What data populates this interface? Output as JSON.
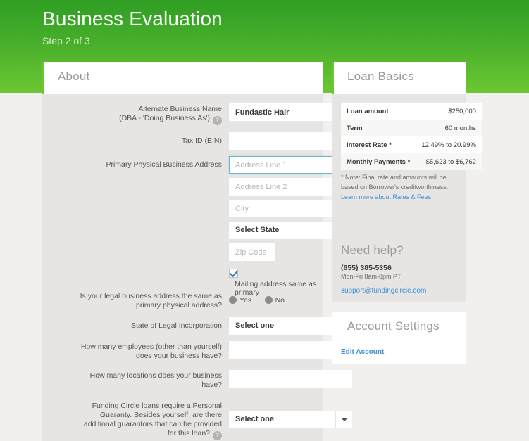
{
  "header": {
    "title": "Business Evaluation",
    "step": "Step 2 of 3"
  },
  "about": {
    "heading": "About",
    "fields": {
      "alt_name_label_line1": "Alternate Business Name",
      "alt_name_label_line2": "(DBA - 'Doing Business As')",
      "alt_name_value": "Fundastic Hair",
      "tax_id_label": "Tax ID (EIN)",
      "tax_id_value": "",
      "address_label": "Primary Physical Business Address",
      "address1_placeholder": "Address Line 1",
      "address2_placeholder": "Address Line 2",
      "city_placeholder": "City",
      "state_value": "Select State",
      "zip_placeholder": "Zip Code",
      "mailing_same_label": "Mailing address same as primary",
      "legal_same_label_line1": "Is your legal business address the same as",
      "legal_same_label_line2": "primary physical address?",
      "radio_yes": "Yes",
      "radio_no": "No",
      "incorporation_label": "State of Legal Incorporation",
      "incorporation_value": "Select one",
      "employees_label_line1": "How many employees (other than yourself)",
      "employees_label_line2": "does your business have?",
      "employees_value": "",
      "locations_label_line1": "How many locations does your business",
      "locations_label_line2": "have?",
      "locations_value": "",
      "guarantor_label_line1": "Funding Circle loans require a Personal",
      "guarantor_label_line2": "Guaranty. Besides yourself, are there",
      "guarantor_label_line3": "additional guarantors that can be provided",
      "guarantor_label_line4": "for this loan?",
      "guarantor_value": "Select one",
      "info_glyph": "?"
    }
  },
  "loan_basics": {
    "heading": "Loan Basics",
    "rows": [
      {
        "key": "Loan amount",
        "value": "$250,000"
      },
      {
        "key": "Term",
        "value": "60 months"
      },
      {
        "key": "Interest Rate *",
        "value": "12.49% to 20.99%"
      },
      {
        "key": "Monthly Payments *",
        "value": "$5,623 to $6,762"
      }
    ],
    "note_text": "* Note: Final rate and amounts will be based on Borrower's creditworthiness. ",
    "note_link": "Learn more about Rates & Fees",
    "note_tail": "."
  },
  "need_help": {
    "heading": "Need help?",
    "phone": "(855) 385-5356",
    "hours": "Mon-Fri 8am-8pm PT",
    "email": "support@fundingcircle.com"
  },
  "account_settings": {
    "heading": "Account Settings",
    "edit_link": "Edit Account"
  },
  "colors": {
    "green_top": "#2f9e23",
    "green_bottom": "#6cc832",
    "accent_green": "#6cc832",
    "link_blue": "#3e8fd4",
    "focus_blue": "#6ab7d6",
    "panel_gray": "#e6e5e4",
    "page_gray": "#f1f0ef"
  }
}
